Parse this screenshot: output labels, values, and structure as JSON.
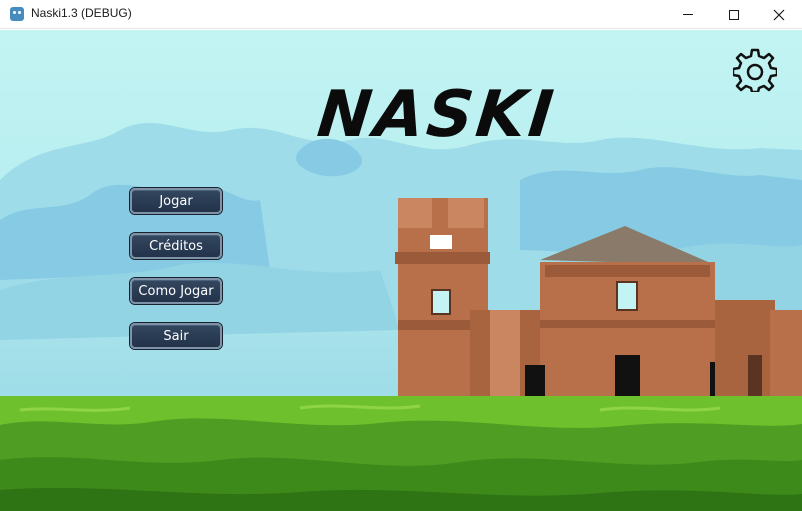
{
  "window": {
    "title": "Naski1.3 (DEBUG)",
    "controls": [
      "minimize",
      "maximize",
      "close"
    ]
  },
  "game": {
    "logo_text": "NASKI",
    "settings_icon": "gear-icon",
    "menu": {
      "play": "Jogar",
      "credits": "Créditos",
      "how_to_play": "Como Jogar",
      "quit": "Sair"
    }
  },
  "colors": {
    "sky": "#b7eef0",
    "cloud": "#86cfe6",
    "grass_light": "#6fc02d",
    "grass_dark": "#3d8a1b",
    "ruin": "#c27a52",
    "button_bg": "#2b3d55",
    "button_border": "#7f93a8"
  }
}
